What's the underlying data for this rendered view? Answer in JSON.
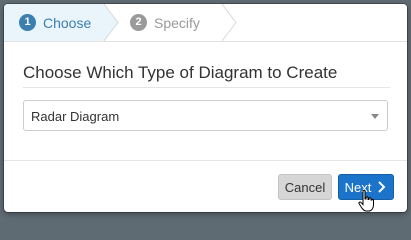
{
  "wizard": {
    "steps": [
      {
        "number": "1",
        "label": "Choose",
        "state": "active"
      },
      {
        "number": "2",
        "label": "Specify",
        "state": "inactive"
      }
    ]
  },
  "main": {
    "heading": "Choose Which Type of Diagram to Create",
    "diagram_type_select": {
      "value": "Radar Diagram"
    }
  },
  "footer": {
    "cancel_label": "Cancel",
    "next_label": "Next"
  },
  "colors": {
    "accent": "#1b74c9",
    "active_step": "#3a7fb0",
    "inactive_step": "#9a9a9a"
  },
  "icons": {
    "next": "chevron-right-icon",
    "select": "caret-down-icon",
    "cursor": "hand-pointer-icon"
  }
}
